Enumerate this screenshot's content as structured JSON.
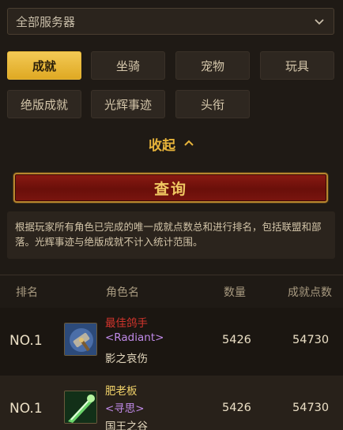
{
  "server_filter": {
    "label": "全部服务器"
  },
  "tabs": [
    {
      "label": "成就",
      "active": true
    },
    {
      "label": "坐骑",
      "active": false
    },
    {
      "label": "宠物",
      "active": false
    },
    {
      "label": "玩具",
      "active": false
    },
    {
      "label": "绝版成就",
      "active": false
    },
    {
      "label": "光辉事迹",
      "active": false
    },
    {
      "label": "头衔",
      "active": false
    }
  ],
  "collapse_label": "收起",
  "query_button_label": "查询",
  "notice_text": "根据玩家所有角色已完成的唯一成就点数总和进行排名，包括联盟和部落。光辉事迹与绝版成就不计入统计范围。",
  "table": {
    "headers": [
      "排名",
      "角色名",
      "数量",
      "成就点数"
    ],
    "rows": [
      {
        "rank": "NO.1",
        "title": "最佳鸽手",
        "guild": "<Radiant>",
        "realm": "影之哀伤",
        "count": "5426",
        "points": "54730",
        "avatar_icon": "hammer-emblem-icon",
        "title_color": "#d0342c"
      },
      {
        "rank": "NO.1",
        "title": "肥老板",
        "guild": "<寻思>",
        "realm": "国王之谷",
        "count": "5426",
        "points": "54730",
        "avatar_icon": "green-spell-icon",
        "title_color": "#f2d36a"
      }
    ]
  },
  "colors": {
    "accent_gold": "#e6b33a",
    "guild_purple": "#c08ae8",
    "button_red": "#8a1a12"
  }
}
